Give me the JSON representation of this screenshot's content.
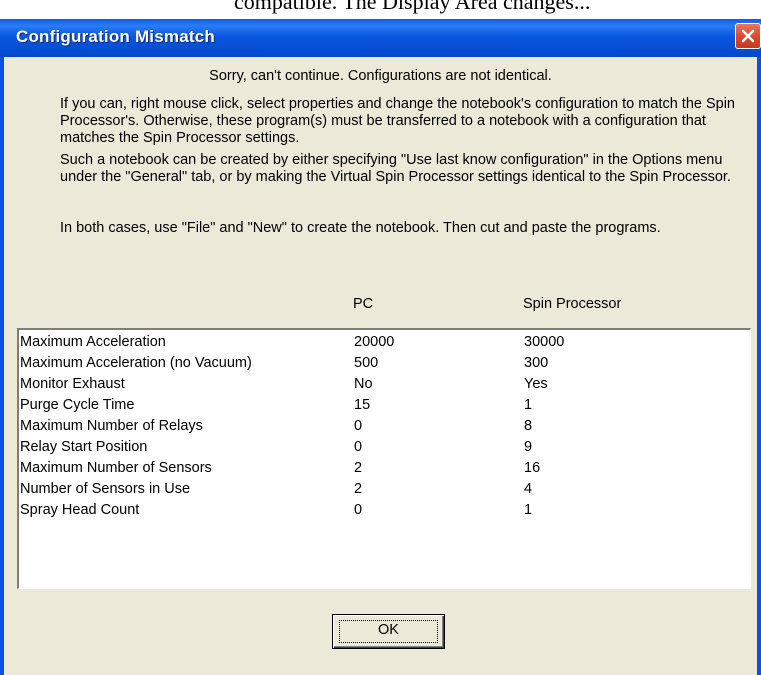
{
  "background_text": "compatible. The Display Area changes...",
  "window": {
    "title": "Configuration Mismatch"
  },
  "message": {
    "headline": "Sorry, can't continue. Configurations are not identical.",
    "paragraph1": "If you can, right mouse click, select properties and change the notebook's configuration to match the Spin Processor's. Otherwise, these program(s) must be transferred to a notebook with a configuration that matches the Spin Processor settings.",
    "paragraph2": "Such a notebook can be created by either specifying \"Use last know configuration\" in the Options menu under the \"General\" tab, or by making the Virtual Spin Processor settings identical to the Spin Processor.",
    "paragraph3": "In both cases, use \"File\" and \"New\" to create the notebook. Then cut and paste the programs."
  },
  "table": {
    "columns": [
      "PC",
      "Spin Processor"
    ],
    "rows": [
      {
        "name": "Maximum Acceleration",
        "pc": "20000",
        "spin": "30000"
      },
      {
        "name": "Maximum Acceleration (no Vacuum)",
        "pc": "500",
        "spin": "300"
      },
      {
        "name": "Monitor Exhaust",
        "pc": "No",
        "spin": "Yes"
      },
      {
        "name": "Purge Cycle Time",
        "pc": "15",
        "spin": "1"
      },
      {
        "name": "Maximum Number of Relays",
        "pc": "0",
        "spin": "8"
      },
      {
        "name": "Relay Start Position",
        "pc": "0",
        "spin": "9"
      },
      {
        "name": "Maximum Number of Sensors",
        "pc": "2",
        "spin": "16"
      },
      {
        "name": "Number of Sensors in Use",
        "pc": "2",
        "spin": "4"
      },
      {
        "name": "Spray Head Count",
        "pc": "0",
        "spin": "1"
      }
    ]
  },
  "buttons": {
    "ok_label": "OK"
  },
  "icons": {
    "close": "close-icon"
  },
  "colors": {
    "titlebar": "#0a52df",
    "close_button": "#d9482a",
    "dialog_face": "#ece9d8"
  }
}
